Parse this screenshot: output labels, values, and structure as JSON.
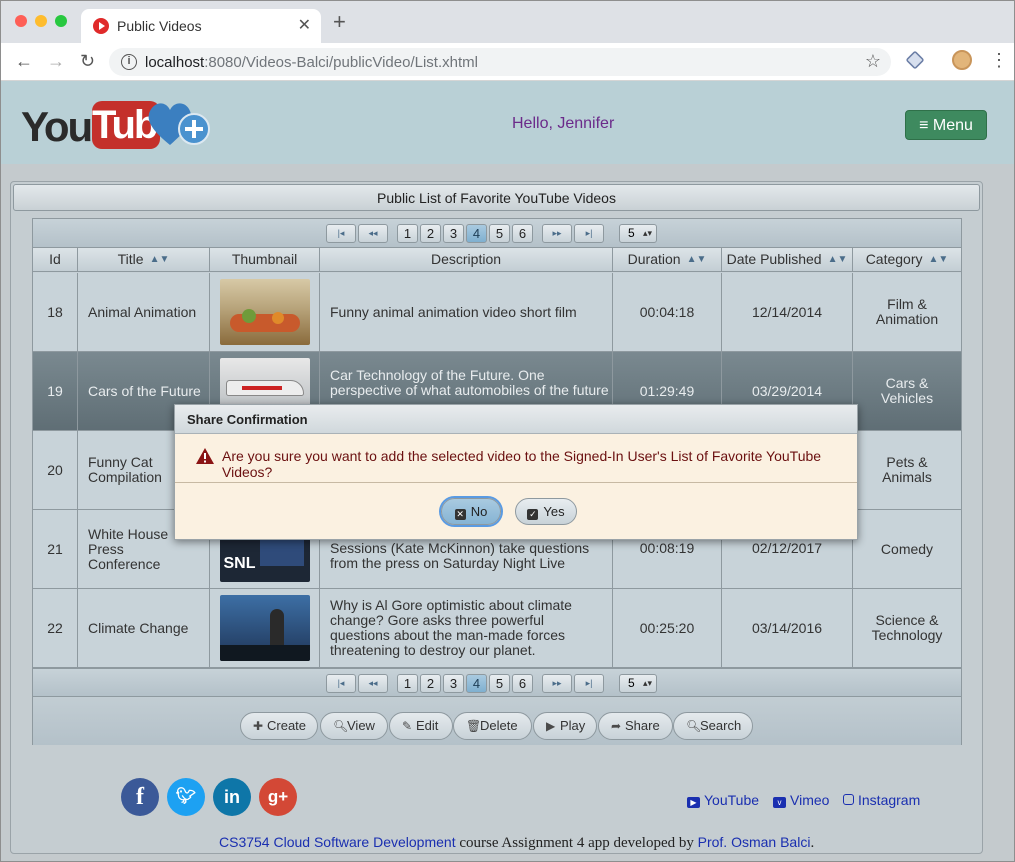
{
  "browser": {
    "tab_title": "Public Videos",
    "url_host": "localhost",
    "url_rest": ":8080/Videos-Balci/publicVideo/List.xhtml"
  },
  "header": {
    "logo_you": "You",
    "logo_tube": "Tube",
    "greeting": "Hello, Jennifer",
    "menu_label": "≡ Menu"
  },
  "panel": {
    "title": "Public List of Favorite YouTube Videos"
  },
  "pager": {
    "pages": [
      "1",
      "2",
      "3",
      "4",
      "5",
      "6"
    ],
    "active_page": "4",
    "rows_per_page": "5"
  },
  "table": {
    "columns": [
      "Id",
      "Title",
      "Thumbnail",
      "Description",
      "Duration",
      "Date Published",
      "Category"
    ],
    "rows": [
      {
        "id": "18",
        "title": "Animal Animation",
        "description": "Funny animal animation video short film",
        "duration": "00:04:18",
        "date": "12/14/2014",
        "category": "Film & Animation"
      },
      {
        "id": "19",
        "title": "Cars of the Future",
        "description": "Car Technology of the Future. One perspective of what automobiles of the future",
        "duration": "01:29:49",
        "date": "03/29/2014",
        "category": "Cars & Vehicles"
      },
      {
        "id": "20",
        "title": "Funny Cat Compilation",
        "description": "",
        "duration": "",
        "date": "",
        "category": "Pets & Animals"
      },
      {
        "id": "21",
        "title": "White House Press Conference",
        "description": "Sessions (Kate McKinnon) take questions from the press on Saturday Night Live",
        "duration": "00:08:19",
        "date": "02/12/2017",
        "category": "Comedy"
      },
      {
        "id": "22",
        "title": "Climate Change",
        "description": "Why is Al Gore optimistic about climate change? Gore asks three powerful questions about the man-made forces threatening to destroy our planet.",
        "duration": "00:25:20",
        "date": "03/14/2016",
        "category": "Science & Technology"
      }
    ]
  },
  "actions": [
    "Create",
    "View",
    "Edit",
    "Delete",
    "Play",
    "Share",
    "Search"
  ],
  "dialog": {
    "title": "Share Confirmation",
    "message": "Are you sure you want to add the selected video to the Signed-In User's List of Favorite YouTube Videos?",
    "no_label": "No",
    "yes_label": "Yes"
  },
  "footer": {
    "links": [
      "YouTube",
      "Vimeo",
      "Instagram"
    ],
    "credit_course": "CS3754 Cloud Software Development",
    "credit_mid": " course Assignment 4 app developed by ",
    "credit_author": "Prof. Osman Balci",
    "credit_end": "."
  },
  "colors": {
    "selected_row": "#6b7a81",
    "dialog_bg": "#fbf1e1",
    "menu_button": "#3e8a5f"
  }
}
